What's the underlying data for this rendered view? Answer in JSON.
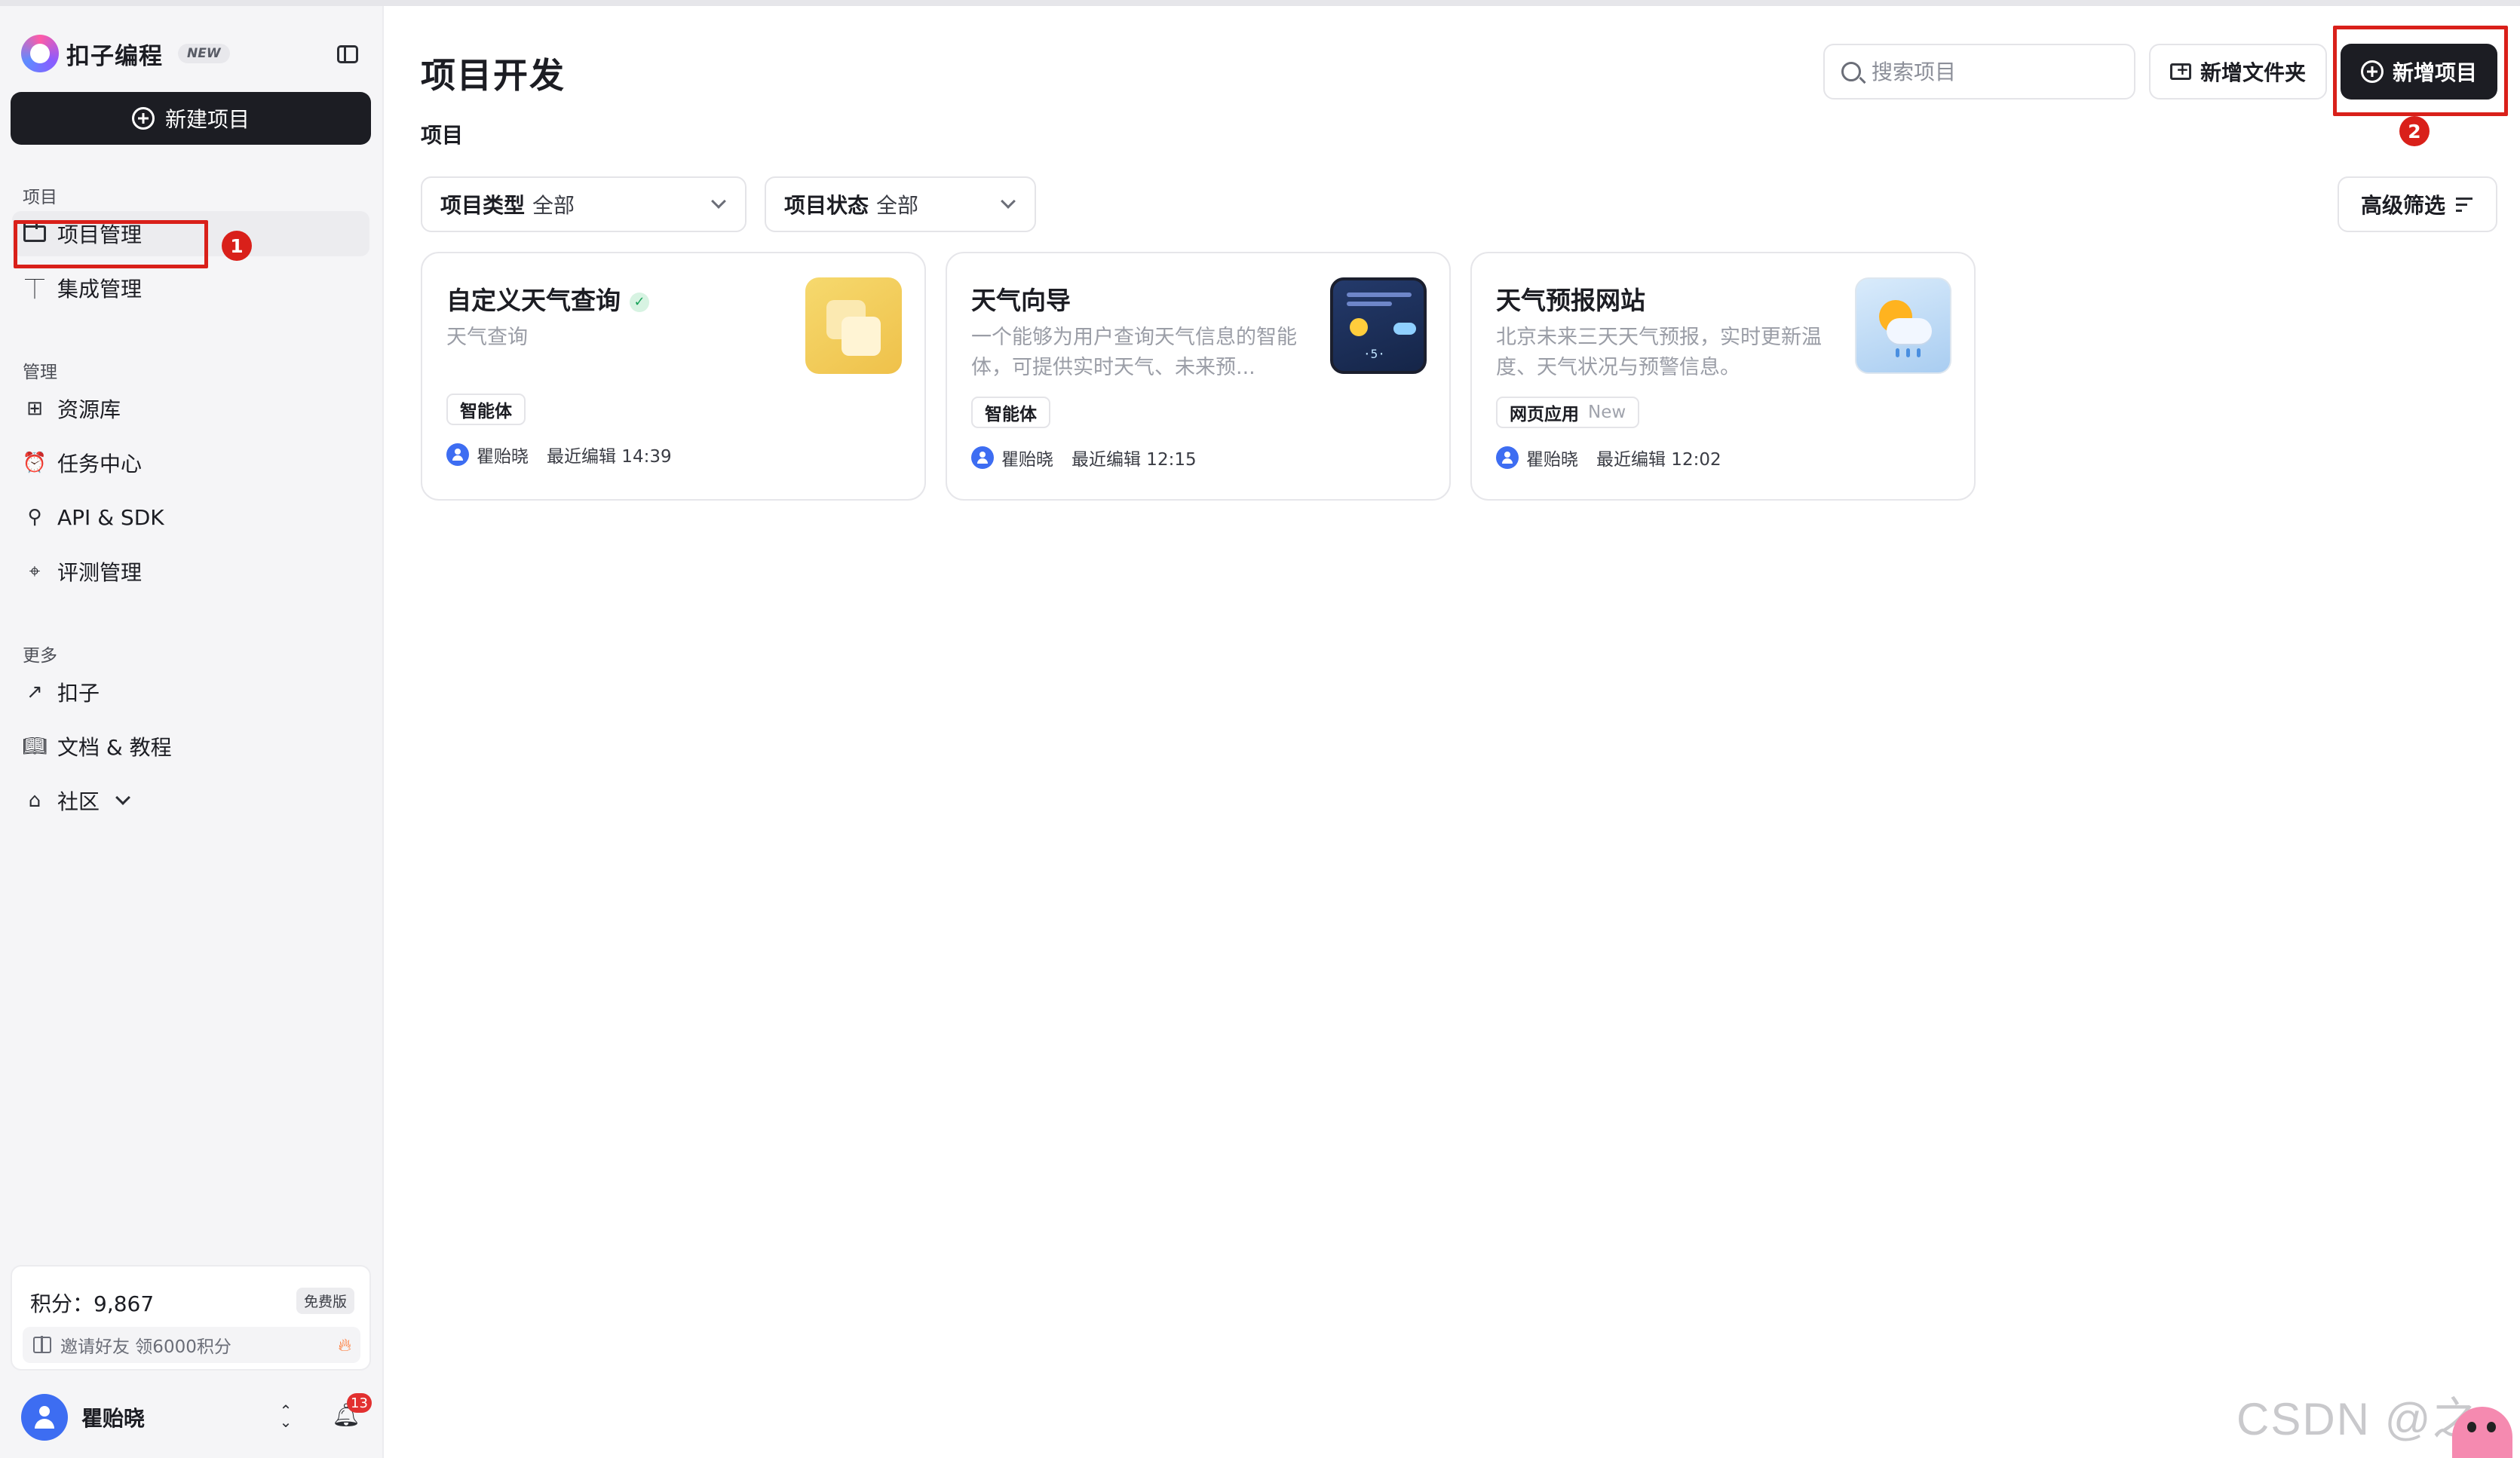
{
  "brand": {
    "name": "扣子编程",
    "badge": "NEW"
  },
  "sidebar": {
    "new_project_label": "新建项目",
    "sections": {
      "project": "项目",
      "manage": "管理",
      "more": "更多"
    },
    "project_items": [
      {
        "label": "项目管理",
        "icon": "folder-icon",
        "active": true
      },
      {
        "label": "集成管理",
        "icon": "plug-icon"
      }
    ],
    "manage_items": [
      {
        "label": "资源库",
        "icon": "library-icon"
      },
      {
        "label": "任务中心",
        "icon": "alarm-clock-icon"
      },
      {
        "label": "API & SDK",
        "icon": "api-icon"
      },
      {
        "label": "评测管理",
        "icon": "telescope-icon"
      }
    ],
    "more_items": [
      {
        "label": "扣子",
        "icon": "arrow-up-right-icon"
      },
      {
        "label": "文档 & 教程",
        "icon": "book-icon"
      },
      {
        "label": "社区",
        "icon": "store-icon"
      }
    ],
    "points": {
      "text": "积分：9,867",
      "plan": "免费版",
      "invite": "邀请好友 领6000积分"
    },
    "user": {
      "name": "瞿贻晓",
      "notifications": "13"
    }
  },
  "annotations": [
    "1",
    "2"
  ],
  "main": {
    "title": "项目开发",
    "subtitle": "项目",
    "search_placeholder": "搜索项目",
    "new_folder_label": "新增文件夹",
    "add_project_label": "新增项目",
    "filters": [
      {
        "label": "项目类型",
        "value": "全部"
      },
      {
        "label": "项目状态",
        "value": "全部"
      }
    ],
    "advanced_filter_label": "高级筛选",
    "cards": [
      {
        "title": "自定义天气查询",
        "verified": true,
        "desc": "天气查询",
        "tag": "智能体",
        "tag_extra": "",
        "author": "瞿贻晓",
        "edited": "最近编辑 14:39",
        "thumb": "yellow-squares"
      },
      {
        "title": "天气向导",
        "verified": false,
        "desc": "一个能够为用户查询天气信息的智能体，可提供实时天气、未来预...",
        "tag": "智能体",
        "tag_extra": "",
        "author": "瞿贻晓",
        "edited": "最近编辑 12:15",
        "thumb": "weather-dashboard"
      },
      {
        "title": "天气预报网站",
        "verified": false,
        "desc": "北京未来三天天气预报，实时更新温度、天气状况与预警信息。",
        "tag": "网页应用",
        "tag_extra": "New",
        "author": "瞿贻晓",
        "edited": "最近编辑 12:02",
        "thumb": "sun-cloud-rain"
      }
    ]
  },
  "watermark": "CSDN @之歆",
  "colors": {
    "accent_dark": "#1c1d23",
    "annotation_red": "#d9201a",
    "avatar_blue": "#3d6df2"
  }
}
